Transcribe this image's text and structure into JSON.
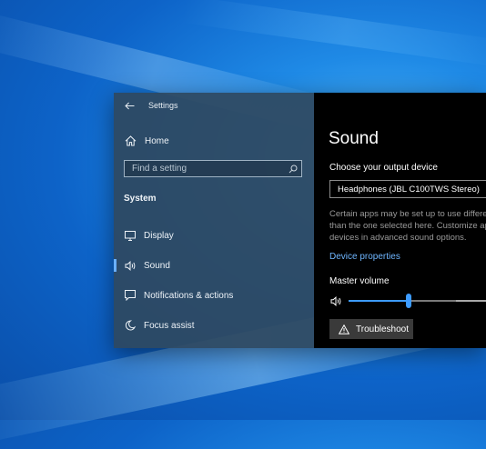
{
  "window": {
    "title": "Settings"
  },
  "sidebar": {
    "home_label": "Home",
    "search_placeholder": "Find a setting",
    "section_title": "System",
    "items": [
      {
        "label": "Display",
        "icon": "monitor-icon"
      },
      {
        "label": "Sound",
        "icon": "speaker-icon",
        "active": true
      },
      {
        "label": "Notifications & actions",
        "icon": "notification-icon"
      },
      {
        "label": "Focus assist",
        "icon": "moon-icon"
      }
    ]
  },
  "sound": {
    "title": "Sound",
    "output_label": "Choose your output device",
    "output_device": "Headphones (JBL C100TWS Stereo)",
    "description_lines": [
      "Certain apps may be set up to use differe",
      "than the one selected here. Customize ap",
      "devices in advanced sound options."
    ],
    "device_properties_link": "Device properties",
    "master_volume_label": "Master volume",
    "master_volume_fraction": 0.41,
    "troubleshoot_label": "Troubleshoot"
  },
  "colors": {
    "accent": "#3d9bff",
    "link": "#6fb6ff",
    "sidebar_bg": "#2e4860",
    "content_bg": "#000000"
  }
}
